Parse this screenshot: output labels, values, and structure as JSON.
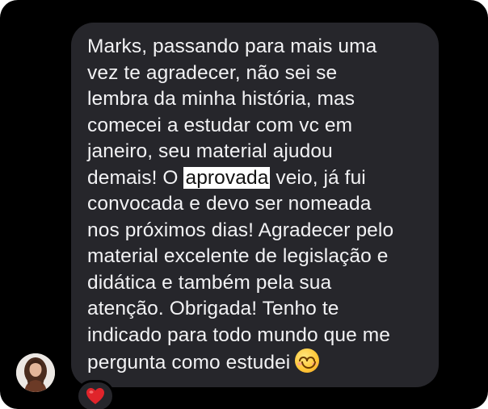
{
  "message": {
    "lines": [
      "Marks, passando para mais uma",
      "vez te agradecer, não sei se",
      "lembra da minha história, mas",
      "comecei a estudar com vc em",
      "janeiro, seu material ajudou"
    ],
    "line6_before": "demais! O ",
    "highlight": "aprovada",
    "line6_after": " veio, já fui",
    "lines_after": [
      "convocada e devo ser nomeada",
      "nos próximos dias! Agradecer pelo",
      "material excelente de legislação e",
      "didática e também pela sua",
      "atenção. Obrigada! Tenho te",
      "indicado para todo mundo que me"
    ],
    "last_line": "pergunta como estudei",
    "emoji_icon": "smiling-face-icon"
  },
  "reaction": {
    "icon": "heart-icon",
    "color": "#e0242b"
  },
  "avatar": {
    "icon": "user-avatar"
  },
  "colors": {
    "background": "#000000",
    "bubble": "#26262b",
    "text": "#f2f2f4",
    "highlight_bg": "#ffffff"
  }
}
